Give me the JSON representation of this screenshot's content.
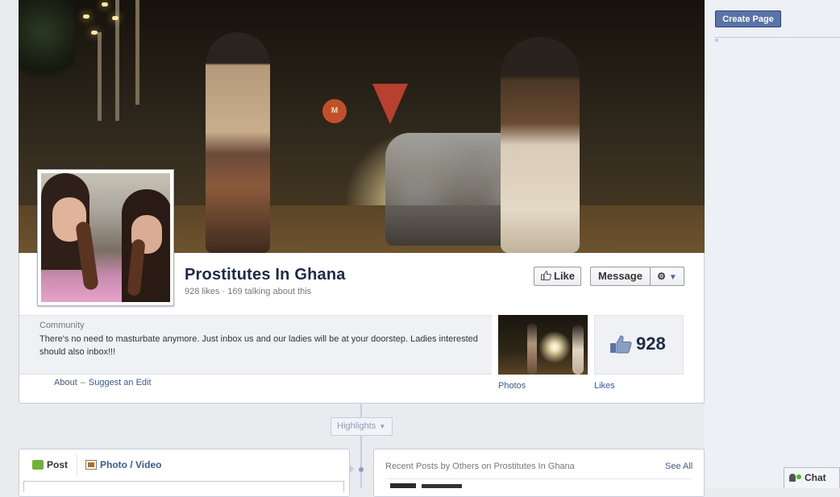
{
  "sidebar_right": {
    "create_page_label": "Create Page"
  },
  "page": {
    "name": "Prostitutes In Ghana",
    "likes_text": "928 likes",
    "talking_text": "169 talking about this",
    "category": "Community",
    "description": "There's no need to masturbate anymore. Just inbox us and our ladies will be at your doorstep. Ladies interested should also inbox!!!"
  },
  "actions": {
    "like_label": "Like",
    "message_label": "Message",
    "gear_icon": "gear-icon"
  },
  "about_links": {
    "about": "About",
    "suggest_edit": "Suggest an Edit",
    "separator": "–"
  },
  "tiles": {
    "photos_label": "Photos",
    "likes_label": "Likes",
    "likes_count": "928"
  },
  "timeline": {
    "highlights_label": "Highlights"
  },
  "composer": {
    "tab_post": "Post",
    "tab_photo": "Photo / Video"
  },
  "recent_posts": {
    "title": "Recent Posts by Others on Prostitutes In Ghana",
    "see_all": "See All"
  },
  "chat": {
    "label": "Chat"
  },
  "colors": {
    "brand_blue": "#3b5998",
    "button_blue": "#5b74a8",
    "online_green": "#42b72a"
  }
}
